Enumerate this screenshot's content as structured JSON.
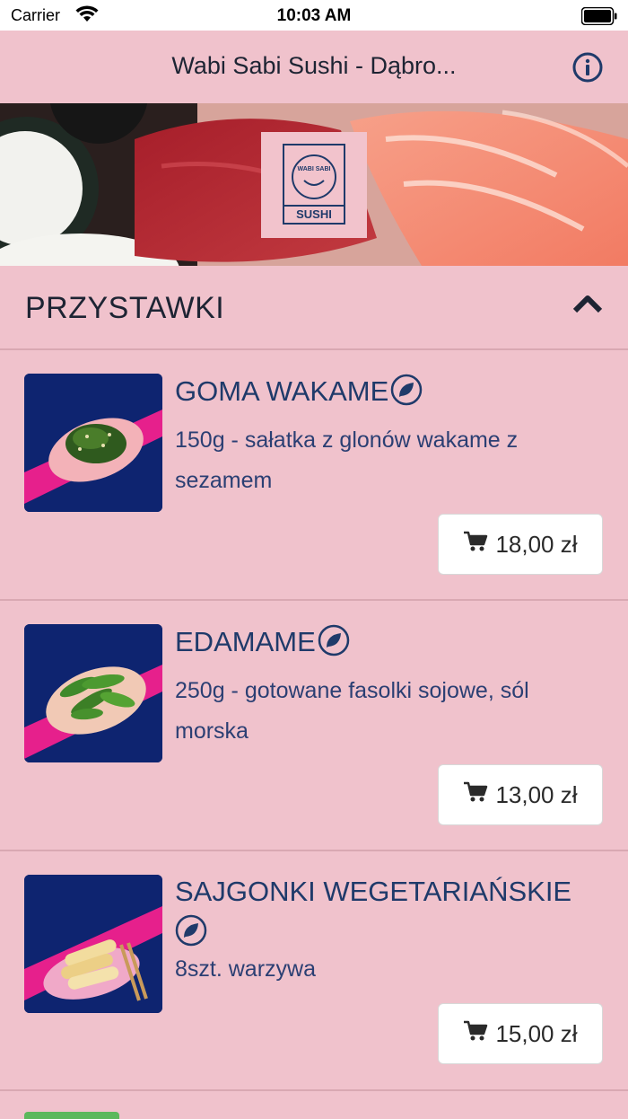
{
  "status_bar": {
    "carrier": "Carrier",
    "time": "10:03 AM"
  },
  "nav": {
    "title": "Wabi Sabi Sushi - Dąbro..."
  },
  "hero": {
    "logo_top_text": "WABI SABI",
    "logo_bottom_text": "SUSHI"
  },
  "section": {
    "title": "PRZYSTAWKI"
  },
  "items": [
    {
      "name": "GOMA WAKAME",
      "desc": "150g - sałatka z glonów wakame z sezamem",
      "price": "18,00 zł"
    },
    {
      "name": "EDAMAME",
      "desc": "250g - gotowane fasolki sojowe, sól morska",
      "price": "13,00 zł"
    },
    {
      "name": "SAJGONKI WEGETARIAŃSKIE",
      "desc": "8szt. warzywa",
      "price": "15,00 zł"
    }
  ],
  "colors": {
    "background": "#f0c2cc",
    "text_primary": "#1f3a6a",
    "button_bg": "#ffffff"
  }
}
